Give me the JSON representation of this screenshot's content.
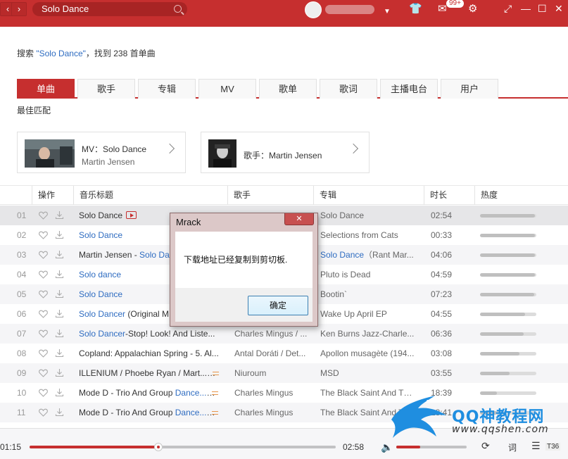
{
  "topbar": {
    "search_value": "Solo Dance",
    "notification_count": "99+",
    "accent_color": "#c62f2f"
  },
  "search_result": {
    "prefix": "搜索 ",
    "keyword": "\"Solo Dance\"",
    "suffix": "，找到 238 首单曲"
  },
  "tabs": [
    {
      "label": "单曲",
      "active": true
    },
    {
      "label": "歌手"
    },
    {
      "label": "专辑"
    },
    {
      "label": "MV"
    },
    {
      "label": "歌单"
    },
    {
      "label": "歌词"
    },
    {
      "label": "主播电台"
    },
    {
      "label": "用户"
    }
  ],
  "best_match": {
    "label": "最佳匹配",
    "mv": {
      "line1": "MV：Solo Dance",
      "line2": "Martin Jensen"
    },
    "artist": {
      "line1": "歌手：Martin Jensen"
    }
  },
  "table": {
    "headers": [
      "操作",
      "音乐标题",
      "歌手",
      "专辑",
      "时长",
      "热度"
    ],
    "rows": [
      {
        "num": "01",
        "title": "Solo Dance",
        "title_link": "",
        "artist": "",
        "album": "Solo Dance",
        "album_link": "",
        "time": "02:54",
        "heat": 0.98,
        "tag": "mv"
      },
      {
        "num": "02",
        "title": "",
        "title_link": "Solo Dance",
        "artist": "",
        "album": "Selections from Cats",
        "album_link": "",
        "time": "00:33",
        "heat": 0.98
      },
      {
        "num": "03",
        "title": "Martin Jensen - ",
        "title_link": "Solo Da",
        "artist": "",
        "album": "（Rant Mar...",
        "album_link": "Solo Dance",
        "time": "04:06",
        "heat": 0.98
      },
      {
        "num": "04",
        "title": "",
        "title_link": "Solo dance",
        "artist": "",
        "album": "Pluto is Dead",
        "album_link": "",
        "time": "04:59",
        "heat": 0.97
      },
      {
        "num": "05",
        "title": "",
        "title_link": "Solo Dance",
        "artist": "",
        "album": "Bootin`",
        "album_link": "",
        "time": "07:23",
        "heat": 0.96
      },
      {
        "num": "06",
        "title": " (Original M",
        "title_link": "Solo Dancer",
        "artist": "",
        "album": "Wake Up April EP",
        "album_link": "",
        "time": "04:55",
        "heat": 0.8
      },
      {
        "num": "07",
        "title": "-Stop! Look! And Liste...",
        "title_link": "Solo Dancer",
        "artist": "Charles Mingus / ...",
        "album": "Ken Burns Jazz-Charle...",
        "album_link": "",
        "time": "06:36",
        "heat": 0.78
      },
      {
        "num": "08",
        "title": "Copland: Appalachian Spring - 5. Al...",
        "title_link": "",
        "artist": "Antal Doráti / Det...",
        "album": "Apollon musagète (194...",
        "album_link": "",
        "time": "03:08",
        "heat": 0.7
      },
      {
        "num": "09",
        "title": "ILLENIUM / Phoebe Ryan / Mart...",
        "title_link": "",
        "artist": "Niuroum",
        "album": "MSD",
        "album_link": "",
        "time": "03:55",
        "heat": 0.52,
        "tag": "sq"
      },
      {
        "num": "10",
        "title": "Mode D - Trio And Group ",
        "title_link": "Dance...",
        "artist": "Charles Mingus",
        "album": "The Black Saint And Th...",
        "album_link": "",
        "time": "18:39",
        "heat": 0.3,
        "tag": "sq"
      },
      {
        "num": "11",
        "title": "Mode D - Trio And Group ",
        "title_link": "Dance...",
        "artist": "Charles Mingus",
        "album": "The Black Saint And Th...",
        "album_link": "",
        "time": "18:41",
        "heat": 0.3,
        "tag": "sq"
      }
    ]
  },
  "dialog": {
    "title": "Mrack",
    "close_label": "✕",
    "message": "下载地址已经复制到剪切板.",
    "ok_label": "确定"
  },
  "player": {
    "current_time": "01:15",
    "total_time": "02:58",
    "progress": 0.42,
    "volume": 0.34,
    "lyric_label": "词",
    "playlist_count": "T36"
  },
  "watermark": {
    "title": "QQ神教程网",
    "url": "www.qqshen.com"
  }
}
